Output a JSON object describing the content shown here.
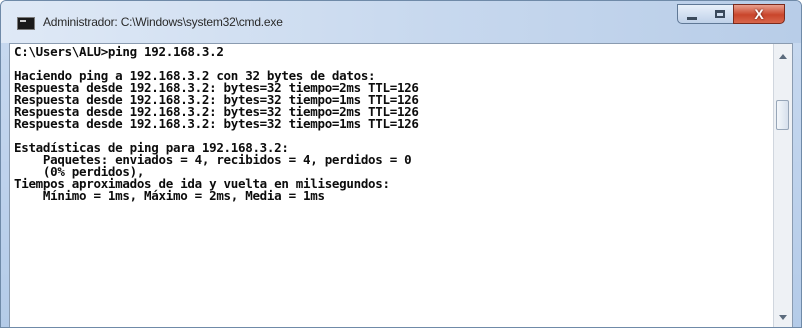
{
  "window": {
    "title": "Administrador: C:\\Windows\\system32\\cmd.exe",
    "icons": {
      "app": "cmd-icon",
      "minimize": "minimize-icon",
      "maximize": "maximize-icon",
      "close": "close-icon"
    },
    "close_glyph": "X"
  },
  "console": {
    "lines": [
      "C:\\Users\\ALU>ping 192.168.3.2",
      "",
      "Haciendo ping a 192.168.3.2 con 32 bytes de datos:",
      "Respuesta desde 192.168.3.2: bytes=32 tiempo=2ms TTL=126",
      "Respuesta desde 192.168.3.2: bytes=32 tiempo=1ms TTL=126",
      "Respuesta desde 192.168.3.2: bytes=32 tiempo=2ms TTL=126",
      "Respuesta desde 192.168.3.2: bytes=32 tiempo=1ms TTL=126",
      "",
      "Estadísticas de ping para 192.168.3.2:",
      "    Paquetes: enviados = 4, recibidos = 4, perdidos = 0",
      "    (0% perdidos),",
      "Tiempos aproximados de ida y vuelta en milisegundos:",
      "    Mínimo = 1ms, Máximo = 2ms, Media = 1ms"
    ]
  },
  "scrollbar": {
    "up_icon": "scroll-up-arrow-icon",
    "down_icon": "scroll-down-arrow-icon"
  },
  "colors": {
    "console_background": "#ffffff",
    "console_text": "#0c0c0c",
    "title_bar": "#c7d8ee",
    "close_button": "#c9452b"
  }
}
